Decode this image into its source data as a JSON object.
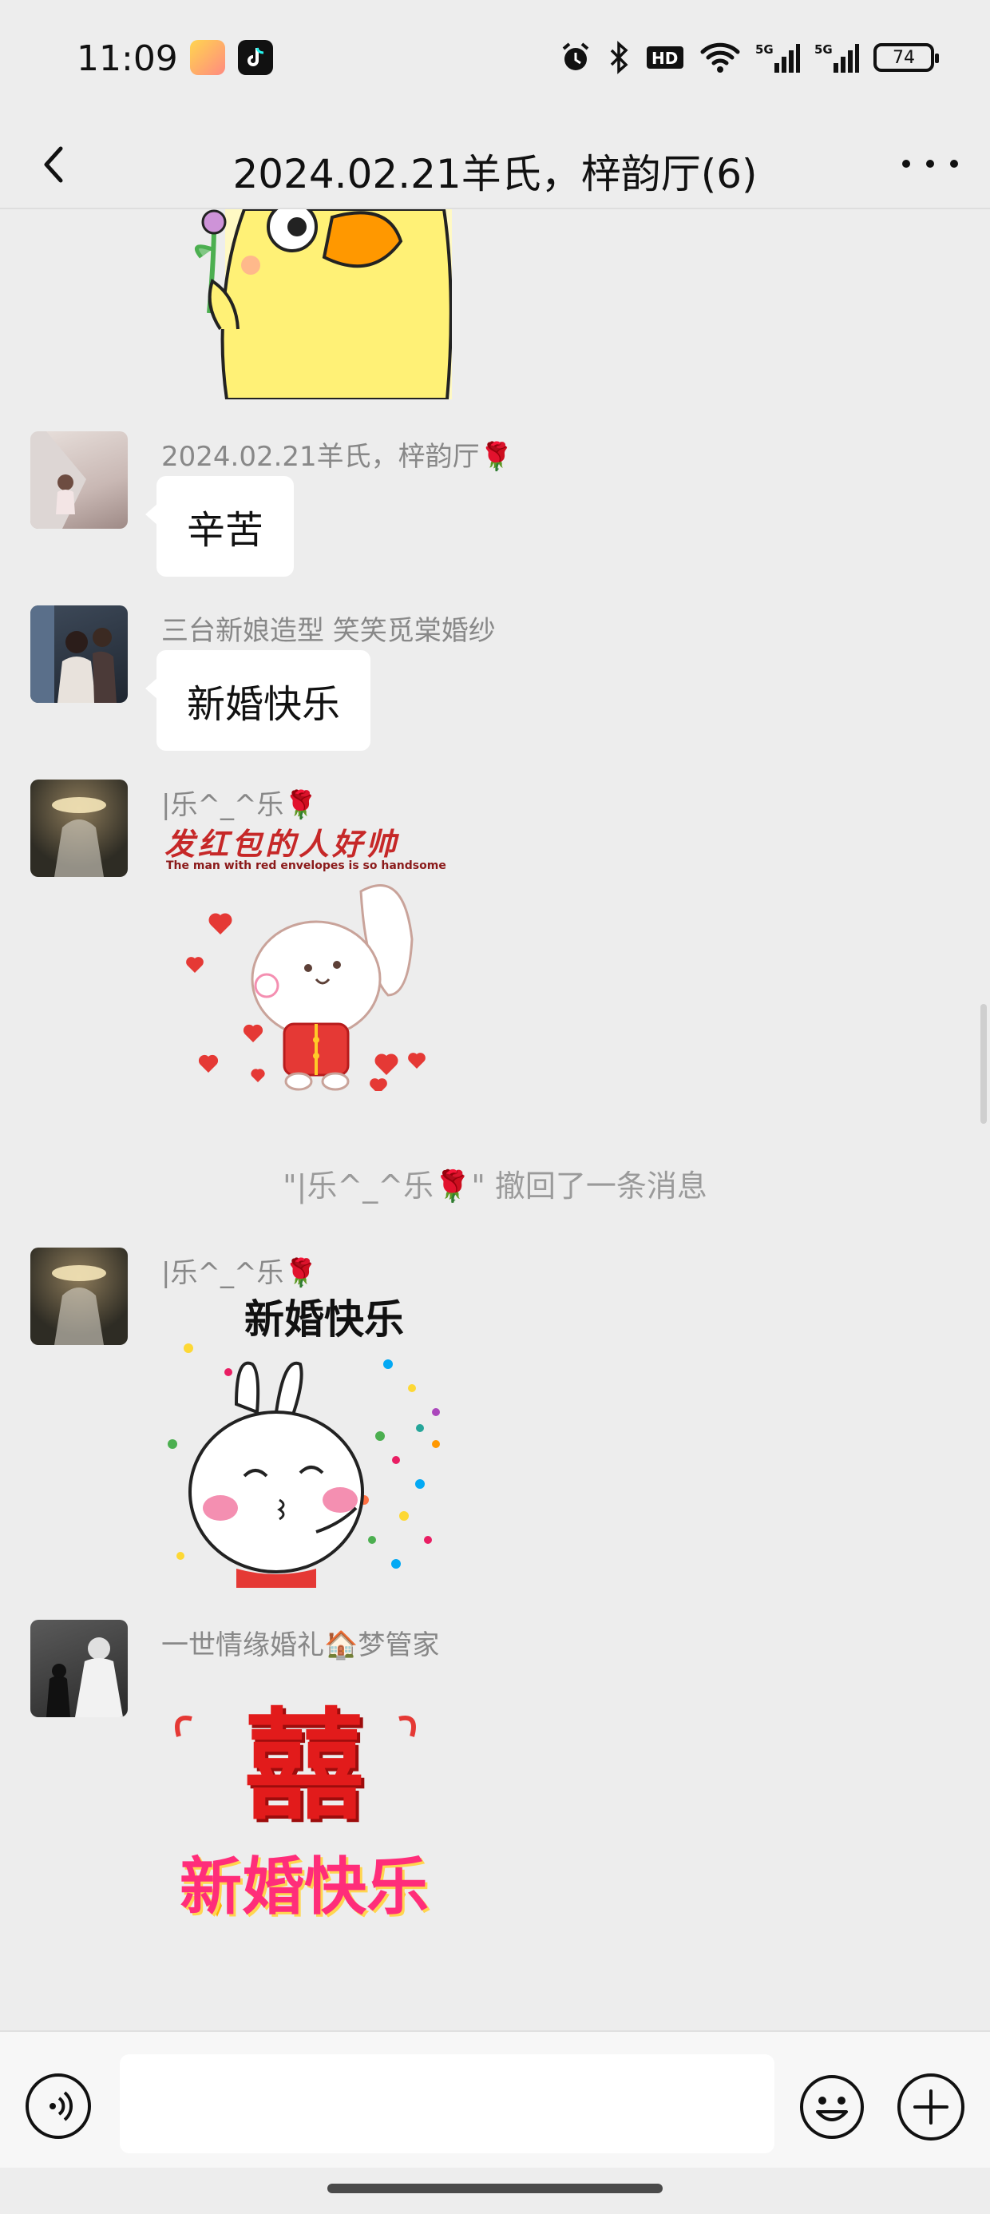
{
  "status_bar": {
    "time": "11:09",
    "battery_level": "74",
    "icons": [
      "app-icon-pink",
      "tiktok-icon",
      "alarm-icon",
      "bluetooth-icon",
      "hd-icon",
      "wifi-icon",
      "signal-5g-icon",
      "signal-5g-icon",
      "battery-icon"
    ]
  },
  "header": {
    "title": "2024.02.21羊氏，梓韵厅(6)"
  },
  "messages": [
    {
      "type": "sticker",
      "sticker": "duck-with-flower-sticker"
    },
    {
      "type": "text",
      "sender": "2024.02.21羊氏，梓韵厅",
      "sender_emoji": "🌹",
      "text": "辛苦"
    },
    {
      "type": "text",
      "sender": "三台新娘造型 笑笑觅棠婚纱",
      "text": "新婚快乐"
    },
    {
      "type": "sticker",
      "sender": "|乐^_^乐",
      "sender_emoji": "🌹",
      "sticker_title": "发红包的人好帅",
      "sticker_subtitle": "The man with red envelopes is so handsome"
    },
    {
      "type": "system",
      "text": "\"|乐^_^乐🌹\" 撤回了一条消息"
    },
    {
      "type": "sticker",
      "sender": "|乐^_^乐",
      "sender_emoji": "🌹",
      "sticker_title": "新婚快乐"
    },
    {
      "type": "sticker",
      "sender": "一世情缘婚礼",
      "sender_emoji": "🏠",
      "sender_suffix": "梦管家",
      "sticker_title": "囍",
      "sticker_subtitle": "新婚快乐"
    }
  ],
  "colors": {
    "background": "#ededed",
    "bubble": "#ffffff",
    "meta_text": "#888888",
    "heart_red": "#e53935"
  }
}
